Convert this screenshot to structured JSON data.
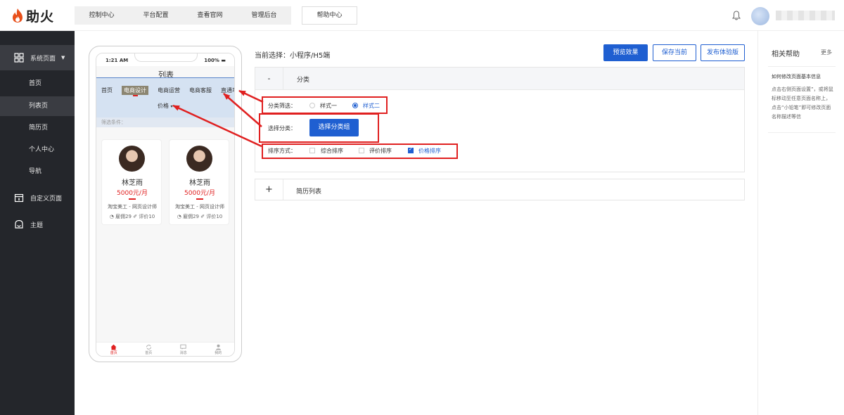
{
  "brand": {
    "name": "助火",
    "color": "#e8501b"
  },
  "topnav": {
    "items": [
      "控制中心",
      "平台配置",
      "查看官网",
      "管理后台"
    ],
    "help": "帮助中心"
  },
  "sidebar": {
    "section_label": "系统页面",
    "sub_items": [
      "首页",
      "列表页",
      "简历页",
      "个人中心",
      "导航"
    ],
    "custom_label": "自定义页面",
    "theme_label": "主题"
  },
  "phone": {
    "time": "1:21 AM",
    "battery": "100%",
    "title": "列表",
    "categories": [
      "首页",
      "电商设计",
      "电商运营",
      "电商客服",
      "直通车"
    ],
    "price_filter": "价格",
    "filter_label": "筛选条件：",
    "cards": [
      {
        "name": "林芝雨",
        "salary": "5000元/月",
        "job": "淘宝美工 - 网页设计师",
        "stats": "◔ 雇佣29 ✐ 评价10"
      },
      {
        "name": "林芝雨",
        "salary": "5000元/月",
        "job": "淘宝美工 - 网页设计师",
        "stats": "◔ 雇佣29 ✐ 评价10"
      }
    ],
    "tabs": [
      "首页",
      "首页",
      "消息",
      "我的"
    ]
  },
  "editor": {
    "current": "当前选择：小程序/H5端",
    "preview": "预览效果",
    "save": "保存当前",
    "publish": "发布体验版",
    "section1": {
      "toggle": "-",
      "label": "分类",
      "filter_label": "分类筛选：",
      "filter_options": [
        "样式一",
        "样式二"
      ],
      "select_label": "选择分类：",
      "select_button": "选择分类组",
      "sort_label": "排序方式：",
      "sort_options": [
        "综合排序",
        "评价排序",
        "价格排序"
      ]
    },
    "section2": {
      "toggle": "+",
      "label": "简历列表"
    }
  },
  "help": {
    "title": "相关帮助",
    "more": "更多",
    "question": "如何修改页面基本信息",
    "answer": "点击右侧页面设置”，或将鼠标移动至任意页面名称上，点击“小铅笔”即可修改页面名称描述等信"
  },
  "colors": {
    "primary": "#1f5fd1",
    "annotation": "#e02020",
    "sidebar": "#24262b"
  }
}
